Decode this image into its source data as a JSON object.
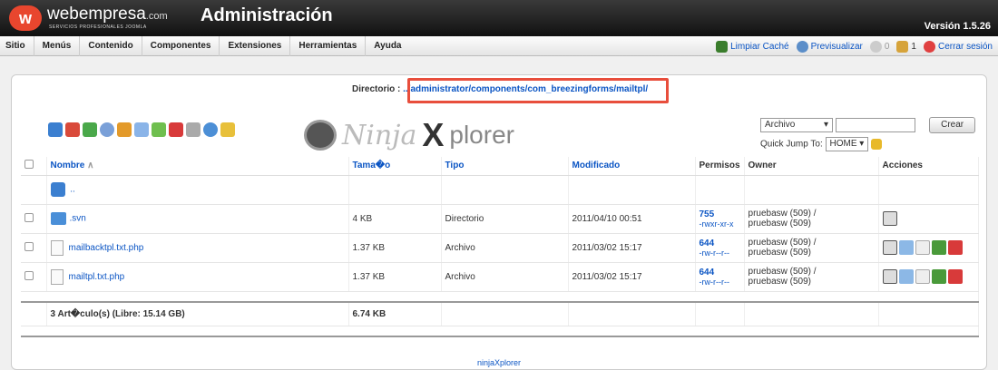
{
  "header": {
    "logo_text": "webempresa",
    "logo_com": ".com",
    "logo_sub": "SERVICIOS PROFESIONALES JOOMLA",
    "title": "Administración",
    "version": "Versión 1.5.26"
  },
  "menu": {
    "items": [
      "Sitio",
      "Menús",
      "Contenido",
      "Componentes",
      "Extensiones",
      "Herramientas",
      "Ayuda"
    ],
    "clear_cache": "Limpiar Caché",
    "preview": "Previsualizar",
    "messages_count": "0",
    "users_count": "1",
    "logout": "Cerrar sesión"
  },
  "explorer": {
    "dir_label": "Directorio :",
    "dir_path": "../administrator/components/com_breezingforms/mailtpl/",
    "logo_ninja": "Ninja",
    "logo_x": "X",
    "logo_plorer": "plorer",
    "create_select": "Archivo",
    "create_button": "Crear",
    "quick_jump_label": "Quick Jump To:",
    "quick_jump_value": "HOME"
  },
  "table": {
    "headers": {
      "name": "Nombre",
      "size": "Tama�o",
      "type": "Tipo",
      "modified": "Modificado",
      "perms": "Permisos",
      "owner": "Owner",
      "actions": "Acciones"
    },
    "up_label": "..",
    "rows": [
      {
        "name": ".svn",
        "size": "4 KB",
        "type": "Directorio",
        "modified": "2011/04/10 00:51",
        "perm_num": "755",
        "perm_str": "-rwxr-xr-x",
        "owner1": "pruebasw (509) /",
        "owner2": "pruebasw (509)"
      },
      {
        "name": "mailbacktpl.txt.php",
        "size": "1.37 KB",
        "type": "Archivo",
        "modified": "2011/03/02 15:17",
        "perm_num": "644",
        "perm_str": "-rw-r--r--",
        "owner1": "pruebasw (509) /",
        "owner2": "pruebasw (509)"
      },
      {
        "name": "mailtpl.txt.php",
        "size": "1.37 KB",
        "type": "Archivo",
        "modified": "2011/03/02 15:17",
        "perm_num": "644",
        "perm_str": "-rw-r--r--",
        "owner1": "pruebasw (509) /",
        "owner2": "pruebasw (509)"
      }
    ],
    "summary": "3 Art�culo(s) (Libre: 15.14 GB)",
    "total_size": "6.74 KB"
  },
  "footer": "ninjaXplorer"
}
